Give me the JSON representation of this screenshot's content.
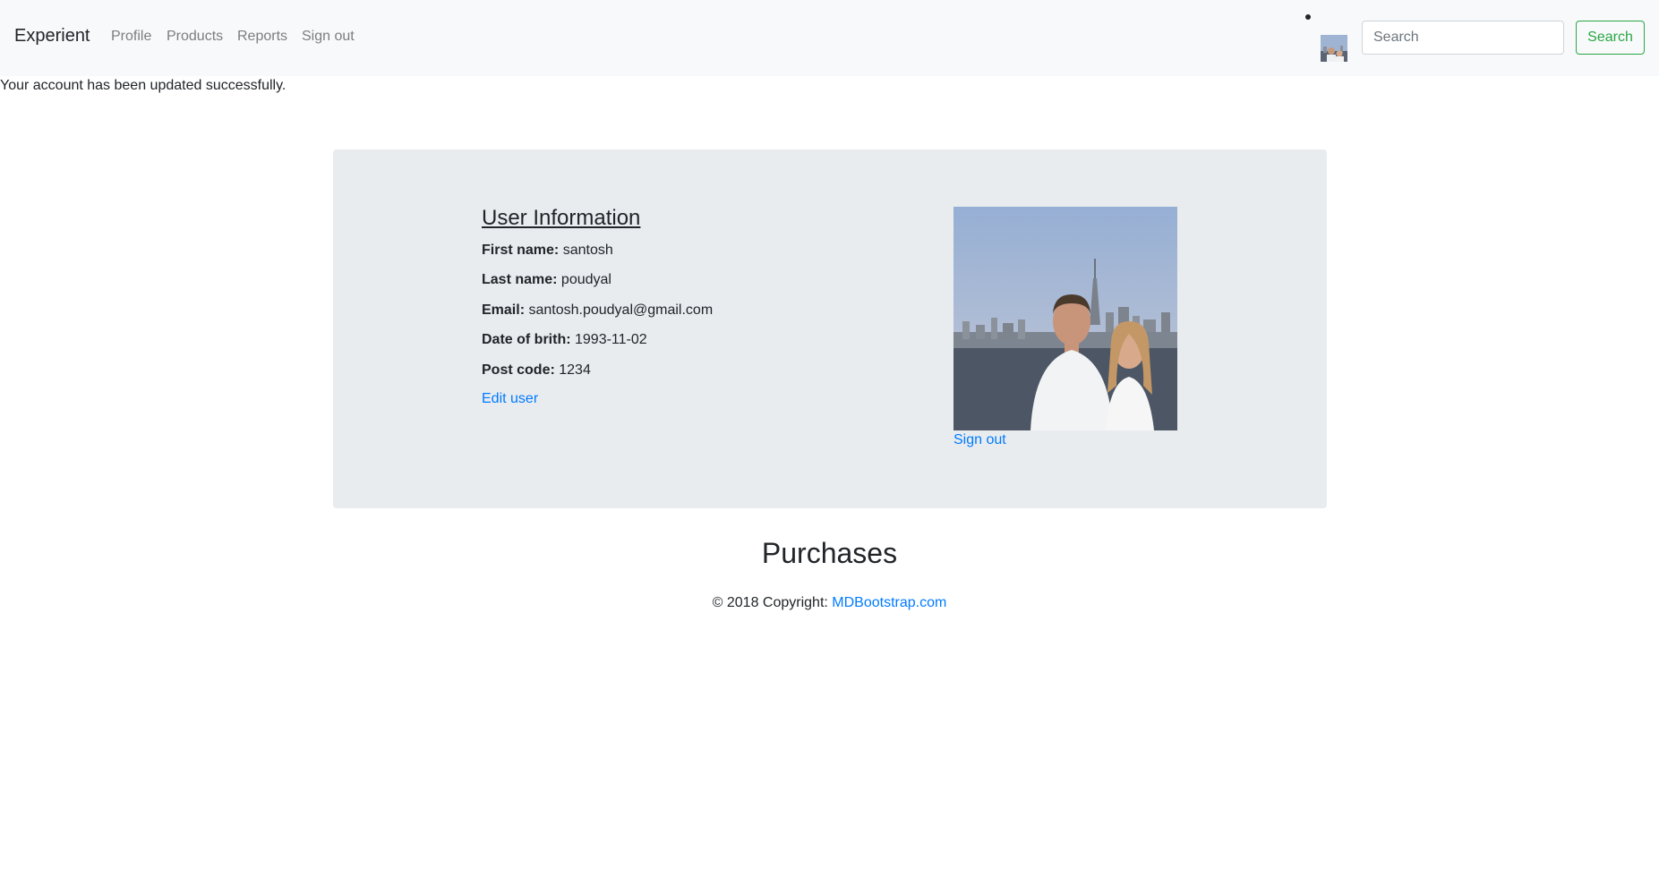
{
  "navbar": {
    "brand": "Experient",
    "links": [
      "Profile",
      "Products",
      "Reports",
      "Sign out"
    ],
    "search_placeholder": "Search",
    "search_button": "Search"
  },
  "flash_message": "Your account has been updated successfully.",
  "user_info": {
    "title": "User Information",
    "fields": [
      {
        "label": "First name:",
        "value": "santosh"
      },
      {
        "label": "Last name:",
        "value": "poudyal"
      },
      {
        "label": "Email:",
        "value": "santosh.poudyal@gmail.com"
      },
      {
        "label": "Date of brith:",
        "value": "1993-11-02"
      },
      {
        "label": "Post code:",
        "value": "1234"
      }
    ],
    "edit_link": "Edit user",
    "sign_out_link": "Sign out"
  },
  "purchases_title": "Purchases",
  "footer": {
    "copyright": "© 2018 Copyright:",
    "link_text": "MDBootstrap.com"
  },
  "colors": {
    "navbar_bg": "#f8f9fa",
    "card_bg": "#e9ecef",
    "link": "#007bff",
    "search_button": "#28a745"
  },
  "icons": {
    "avatar": "user-photo",
    "profile_photo": "user-photo"
  }
}
